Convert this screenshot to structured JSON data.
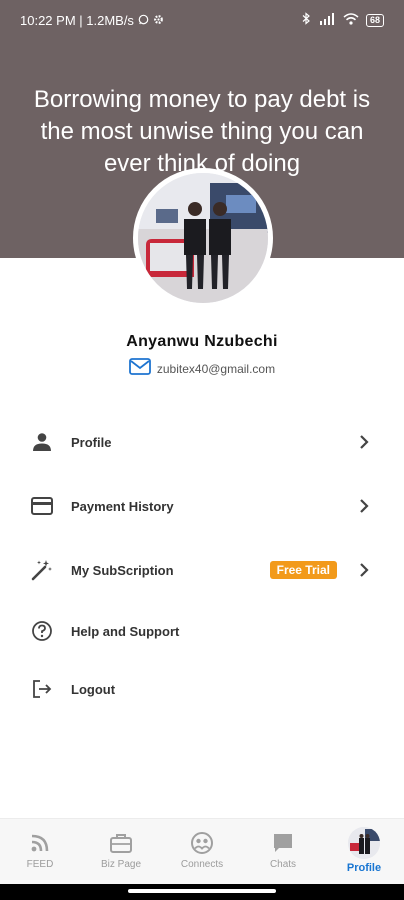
{
  "status_bar": {
    "time_and_speed": "10:22 PM | 1.2MB/s",
    "battery": "68"
  },
  "header": {
    "quote": "Borrowing money to pay debt is the most unwise thing you can ever think of doing"
  },
  "profile": {
    "name": "Anyanwu Nzubechi",
    "email": "zubitex40@gmail.com"
  },
  "menu": {
    "items": [
      {
        "label": "Profile",
        "icon": "person-icon"
      },
      {
        "label": "Payment History",
        "icon": "credit-card-icon"
      },
      {
        "label": "My SubScription",
        "icon": "magic-wand-icon",
        "badge": "Free Trial"
      },
      {
        "label": "Help and Support",
        "icon": "help-circle-icon"
      },
      {
        "label": "Logout",
        "icon": "logout-icon"
      }
    ]
  },
  "bottom_nav": {
    "items": [
      {
        "label": "FEED",
        "icon": "rss-icon"
      },
      {
        "label": "Biz Page",
        "icon": "briefcase-icon"
      },
      {
        "label": "Connects",
        "icon": "connects-icon"
      },
      {
        "label": "Chats",
        "icon": "chat-icon"
      },
      {
        "label": "Profile",
        "icon": "avatar",
        "active": true
      }
    ]
  },
  "colors": {
    "banner": "#6e6263",
    "accent": "#1976d2",
    "badge": "#f29a1b"
  }
}
